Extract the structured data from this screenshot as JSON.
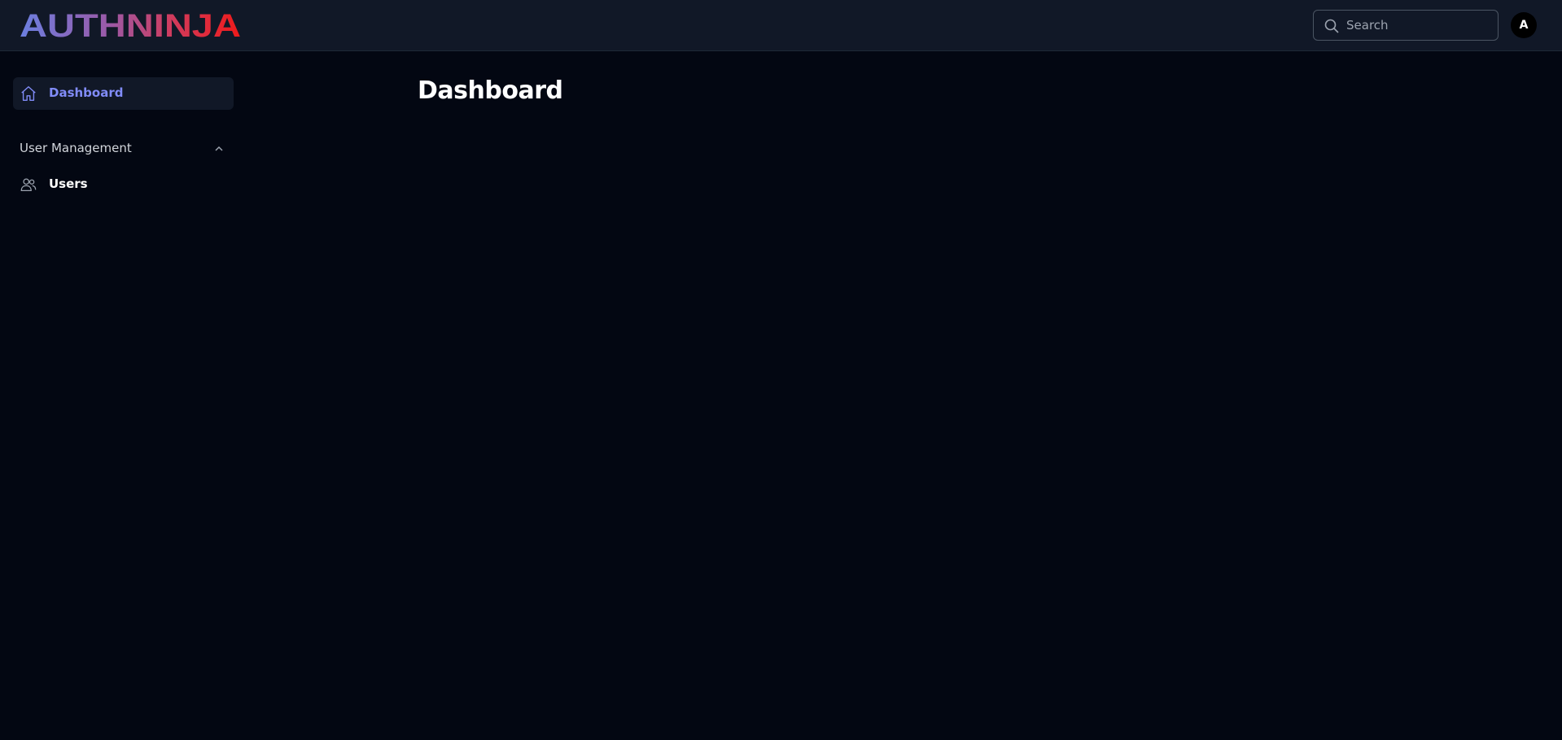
{
  "app": {
    "logo_text": "AUTHNINJA"
  },
  "header": {
    "search": {
      "placeholder": "Search",
      "value": ""
    },
    "avatar_initial": "A"
  },
  "sidebar": {
    "items": [
      {
        "label": "Dashboard",
        "icon": "home-icon",
        "active": true
      }
    ],
    "groups": [
      {
        "label": "User Management",
        "expanded": true,
        "items": [
          {
            "label": "Users",
            "icon": "users-icon"
          }
        ]
      }
    ]
  },
  "main": {
    "title": "Dashboard"
  },
  "colors": {
    "background": "#030712",
    "topbar": "#111827",
    "accent": "#818cf8",
    "logo_gradient_start": "#6366f1",
    "logo_gradient_end": "#ef1a1a"
  }
}
